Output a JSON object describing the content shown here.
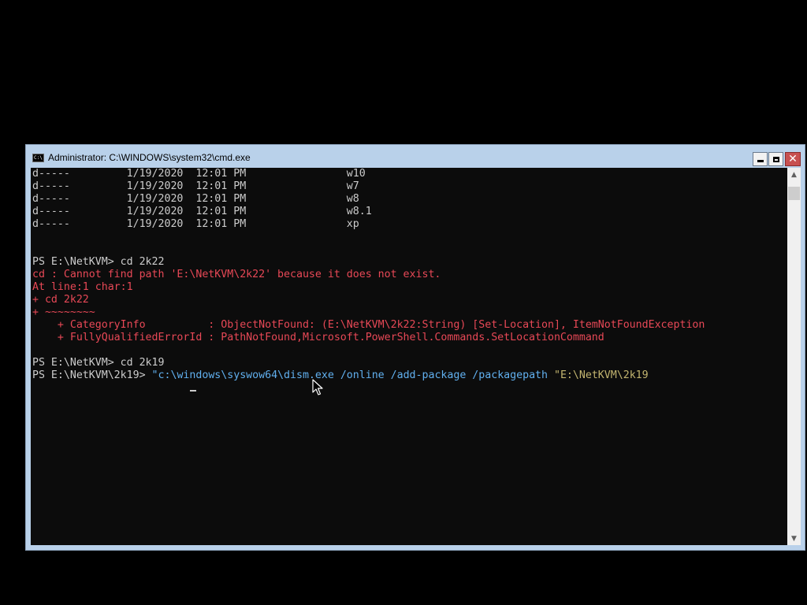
{
  "window": {
    "title": "Administrator: C:\\WINDOWS\\system32\\cmd.exe",
    "icon": "cmd-icon",
    "icon_text": "C:\\",
    "controls": [
      "minimize-button",
      "maximize-button",
      "close-button"
    ],
    "close_glyph": "✕",
    "colors": {
      "frame": "#b9d1ea",
      "console_bg": "#0c0c0c",
      "close": "#c75050"
    }
  },
  "terminal": {
    "colors": {
      "text": "#cccccc",
      "error": "#e74856",
      "argument": "#61b0ef",
      "string": "#c2b46f"
    },
    "lines": [
      {
        "text": "d-----         1/19/2020  12:01 PM                w10",
        "type": "normal"
      },
      {
        "text": "d-----         1/19/2020  12:01 PM                w7",
        "type": "normal"
      },
      {
        "text": "d-----         1/19/2020  12:01 PM                w8",
        "type": "normal"
      },
      {
        "text": "d-----         1/19/2020  12:01 PM                w8.1",
        "type": "normal"
      },
      {
        "text": "d-----         1/19/2020  12:01 PM                xp",
        "type": "normal"
      },
      {
        "text": "",
        "type": "normal"
      },
      {
        "text": "",
        "type": "normal"
      },
      {
        "text": "PS E:\\NetKVM> cd 2k22",
        "type": "normal"
      },
      {
        "text": "cd : Cannot find path 'E:\\NetKVM\\2k22' because it does not exist.",
        "type": "error"
      },
      {
        "text": "At line:1 char:1",
        "type": "error"
      },
      {
        "text": "+ cd 2k22",
        "type": "error"
      },
      {
        "text": "+ ~~~~~~~~",
        "type": "error"
      },
      {
        "text": "    + CategoryInfo          : ObjectNotFound: (E:\\NetKVM\\2k22:String) [Set-Location], ItemNotFoundException",
        "type": "error"
      },
      {
        "text": "    + FullyQualifiedErrorId : PathNotFound,Microsoft.PowerShell.Commands.SetLocationCommand",
        "type": "error"
      },
      {
        "text": "",
        "type": "normal"
      },
      {
        "text": "PS E:\\NetKVM> cd 2k19",
        "type": "normal"
      }
    ],
    "prompt": "PS E:\\NetKVM\\2k19> ",
    "command_parts": [
      {
        "text": "\"c:\\windows\\syswow64\\dism.exe",
        "role": "arg"
      },
      {
        "text": " /online /add-package /packagepath ",
        "role": "arg"
      },
      {
        "text": "\"E:\\NetKVM\\2k19",
        "role": "str"
      }
    ]
  },
  "scrollbar": {
    "up_arrow": "▲",
    "down_arrow": "▼"
  }
}
